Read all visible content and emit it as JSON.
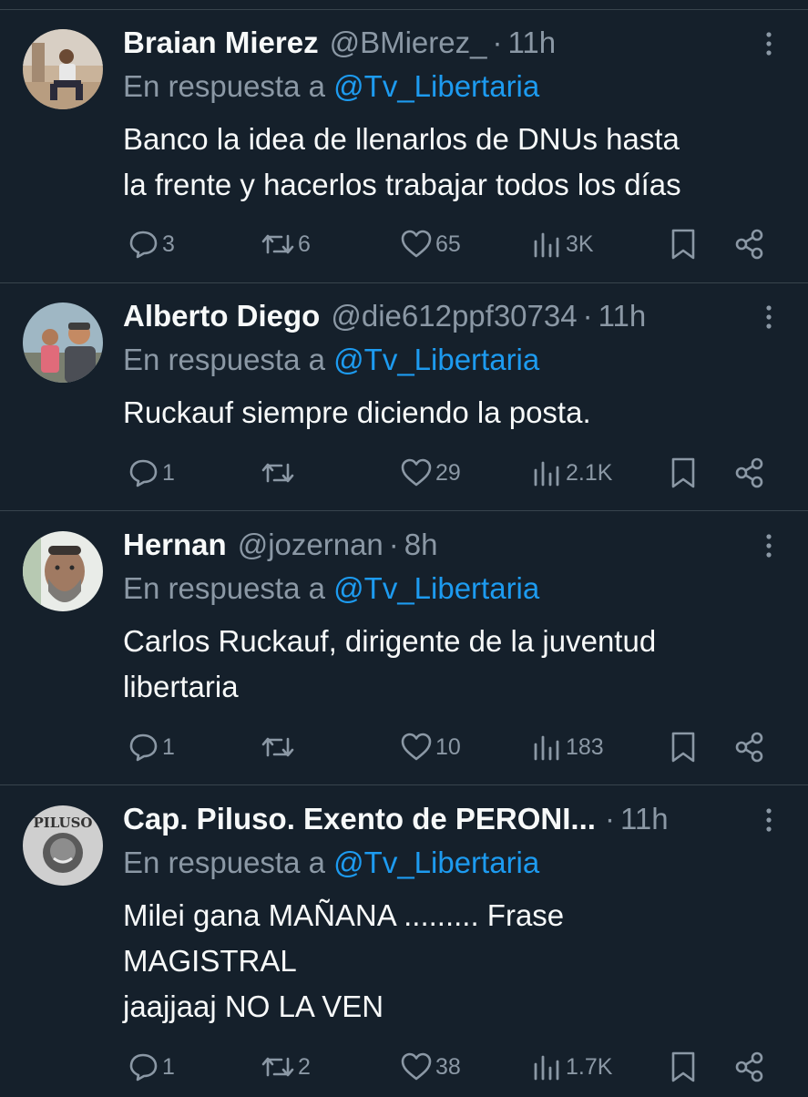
{
  "tweets": [
    {
      "name": "Braian Mierez",
      "handle": "@BMierez_",
      "time": "11h",
      "reply_prefix": "En respuesta a",
      "reply_to": "@Tv_Libertaria",
      "text": "Banco la idea de llenarlos de DNUs hasta\nla frente y hacerlos trabajar todos los días",
      "replies": "3",
      "retweets": "6",
      "likes": "65",
      "views": "3K"
    },
    {
      "name": "Alberto Diego",
      "handle": "@die612ppf30734",
      "time": "11h",
      "reply_prefix": "En respuesta a",
      "reply_to": "@Tv_Libertaria",
      "text": "Ruckauf siempre diciendo la posta.",
      "replies": "1",
      "retweets": "",
      "likes": "29",
      "views": "2.1K"
    },
    {
      "name": "Hernan",
      "handle": "@jozernan",
      "time": "8h",
      "reply_prefix": "En respuesta a",
      "reply_to": "@Tv_Libertaria",
      "text": "Carlos Ruckauf, dirigente de la juventud\nlibertaria",
      "replies": "1",
      "retweets": "",
      "likes": "10",
      "views": "183"
    },
    {
      "name": "Cap. Piluso. Exento de PERONI...",
      "handle": "",
      "time": "11h",
      "reply_prefix": "En respuesta a",
      "reply_to": "@Tv_Libertaria",
      "text": "Milei gana MAÑANA ......... Frase\nMAGISTRAL\njaajjaaj NO LA VEN",
      "replies": "1",
      "retweets": "2",
      "likes": "38",
      "views": "1.7K",
      "avatar_text": "PILUSO"
    }
  ],
  "icons": {
    "reply": "reply-icon",
    "retweet": "retweet-icon",
    "like": "like-icon",
    "views": "views-icon",
    "bookmark": "bookmark-icon",
    "share": "share-icon",
    "more": "more-icon"
  },
  "colors": {
    "background": "#15202b",
    "text": "#f7f9f9",
    "secondary": "#8b98a5",
    "link": "#1d9bf0",
    "divider": "#38444d"
  }
}
